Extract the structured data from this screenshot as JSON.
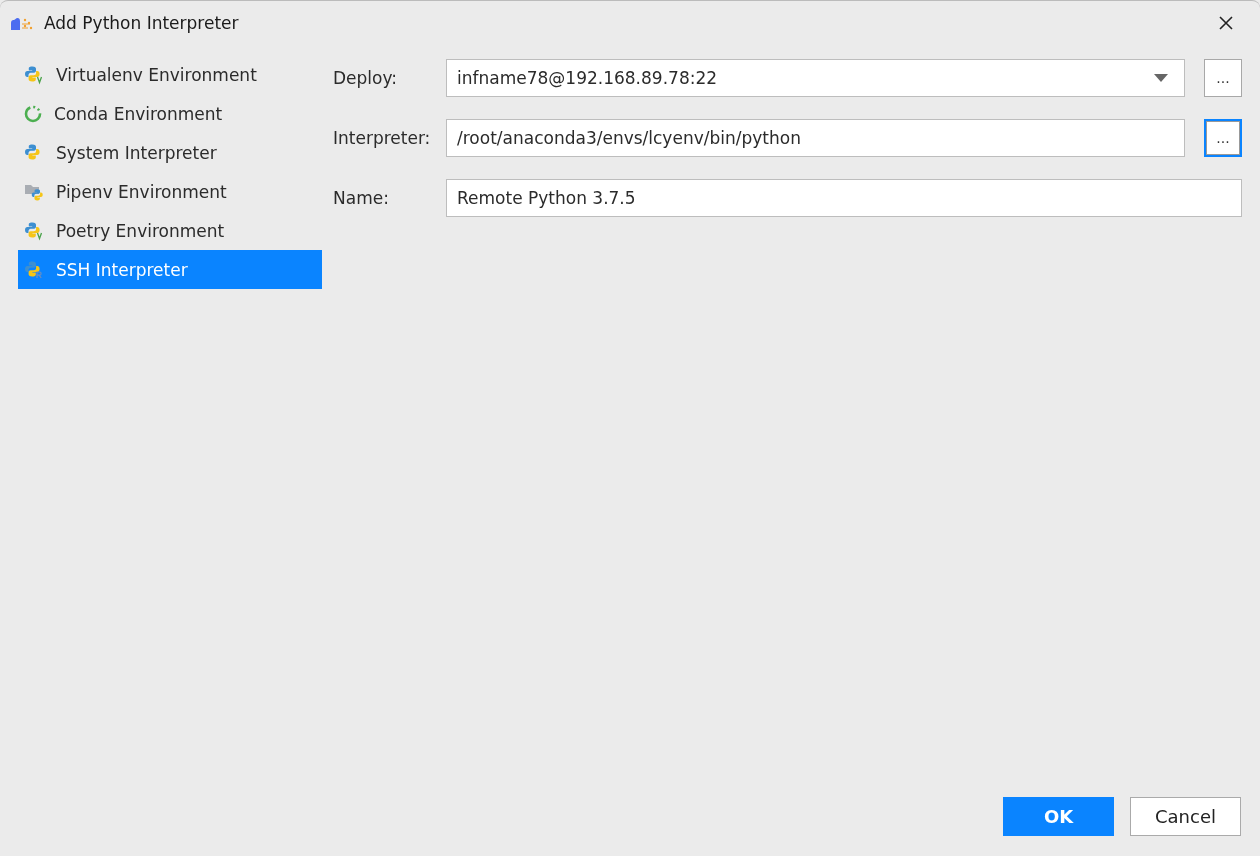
{
  "window": {
    "title": "Add Python Interpreter"
  },
  "sidebar": {
    "items": [
      {
        "label": "Virtualenv Environment",
        "kind": "virtualenv",
        "selected": false
      },
      {
        "label": "Conda Environment",
        "kind": "conda",
        "selected": false
      },
      {
        "label": "System Interpreter",
        "kind": "system",
        "selected": false
      },
      {
        "label": "Pipenv Environment",
        "kind": "pipenv",
        "selected": false
      },
      {
        "label": "Poetry Environment",
        "kind": "virtualenv",
        "selected": false
      },
      {
        "label": "SSH Interpreter",
        "kind": "remote",
        "selected": true
      }
    ]
  },
  "form": {
    "rows": [
      {
        "label": "Deploy:",
        "kind": "dropdown",
        "value": "infname78@192.168.89.78:22",
        "browse": {
          "label": "...",
          "focused": false
        }
      },
      {
        "label": "Interpreter:",
        "kind": "text",
        "value": "/root/anaconda3/envs/lcyenv/bin/python",
        "browse": {
          "label": "...",
          "focused": true
        }
      },
      {
        "label": "Name:",
        "kind": "text",
        "value": "Remote Python 3.7.5"
      }
    ]
  },
  "buttons": [
    {
      "label": "OK",
      "default": true
    },
    {
      "label": "Cancel",
      "default": false
    }
  ]
}
